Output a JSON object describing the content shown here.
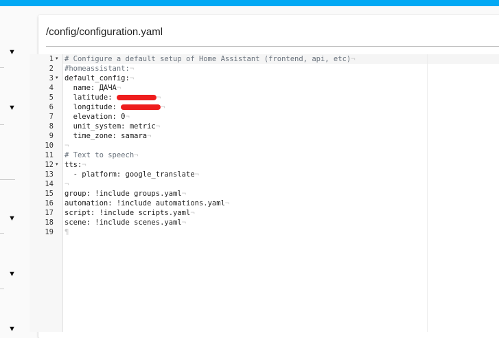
{
  "app": {
    "file_path": "/config/configuration.yaml"
  },
  "sidebar": {
    "toggle_icon": "triangle-down-icon",
    "toggles": [
      "▼",
      "▼",
      "▼",
      "▼",
      "▼",
      "▼"
    ]
  },
  "editor": {
    "lines": [
      {
        "n": "1",
        "text": "# Configure a default setup of Home Assistant (frontend, api, etc)",
        "kind": "comment",
        "fold": true
      },
      {
        "n": "2",
        "text": "#homeassistant:",
        "kind": "comment",
        "fold": false
      },
      {
        "n": "3",
        "text": "default_config:",
        "kind": "code",
        "fold": true
      },
      {
        "n": "4",
        "text": "  name: ДАЧА",
        "kind": "code",
        "fold": false
      },
      {
        "n": "5",
        "text": "  latitude: ",
        "kind": "code",
        "fold": false,
        "redacted": true
      },
      {
        "n": "6",
        "text": "  longitude: ",
        "kind": "code",
        "fold": false,
        "redacted": true
      },
      {
        "n": "7",
        "text": "  elevation: 0",
        "kind": "code",
        "fold": false
      },
      {
        "n": "8",
        "text": "  unit_system: metric",
        "kind": "code",
        "fold": false
      },
      {
        "n": "9",
        "text": "  time_zone: samara",
        "kind": "code",
        "fold": false
      },
      {
        "n": "10",
        "text": "",
        "kind": "code",
        "fold": false
      },
      {
        "n": "11",
        "text": "# Text to speech",
        "kind": "comment",
        "fold": false
      },
      {
        "n": "12",
        "text": "tts:",
        "kind": "code",
        "fold": true
      },
      {
        "n": "13",
        "text": "  - platform: google_translate",
        "kind": "code",
        "fold": false
      },
      {
        "n": "14",
        "text": "",
        "kind": "code",
        "fold": false
      },
      {
        "n": "15",
        "text": "group: !include groups.yaml",
        "kind": "code",
        "fold": false
      },
      {
        "n": "16",
        "text": "automation: !include automations.yaml",
        "kind": "code",
        "fold": false
      },
      {
        "n": "17",
        "text": "script: !include scripts.yaml",
        "kind": "code",
        "fold": false
      },
      {
        "n": "18",
        "text": "scene: !include scenes.yaml",
        "kind": "code",
        "fold": false
      },
      {
        "n": "19",
        "text": "",
        "kind": "code",
        "fold": false
      }
    ],
    "eol_marker": "¬",
    "eof_marker": "¶",
    "fold_icon": "▾"
  },
  "colors": {
    "accent": "#03a9f4",
    "redaction": "#ee1d1d"
  }
}
